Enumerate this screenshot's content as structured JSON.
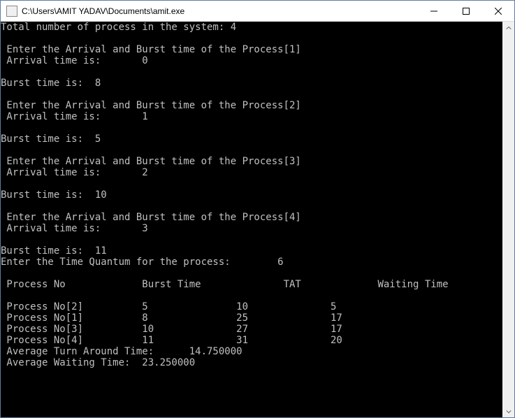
{
  "window": {
    "title": "C:\\Users\\AMIT YADAV\\Documents\\amit.exe"
  },
  "console": {
    "total_prompt": "Total number of process in the system: ",
    "total_value": "4",
    "processes": [
      {
        "idx": "1",
        "arrival": "0",
        "burst": "8"
      },
      {
        "idx": "2",
        "arrival": "1",
        "burst": "5"
      },
      {
        "idx": "3",
        "arrival": "2",
        "burst": "10"
      },
      {
        "idx": "4",
        "arrival": "3",
        "burst": "11"
      }
    ],
    "enter_ab_prefix": " Enter the Arrival and Burst time of the Process[",
    "enter_ab_suffix": "]",
    "arrival_label": " Arrival time is:       ",
    "burst_label": "Burst time is:  ",
    "quantum_prompt": "Enter the Time Quantum for the process:        ",
    "quantum_value": "6",
    "header": {
      "col1": " Process No",
      "col2": "Burst Time",
      "col3": "TAT",
      "col4": "Waiting Time"
    },
    "rows": [
      {
        "p": " Process No[2]",
        "bt": "5",
        "tat": "10",
        "wt": "5"
      },
      {
        "p": " Process No[1]",
        "bt": "8",
        "tat": "25",
        "wt": "17"
      },
      {
        "p": " Process No[3]",
        "bt": "10",
        "tat": "27",
        "wt": "17"
      },
      {
        "p": " Process No[4]",
        "bt": "11",
        "tat": "31",
        "wt": "20"
      }
    ],
    "avg_tat_label": " Average Turn Around Time:      ",
    "avg_tat_value": "14.750000",
    "avg_wt_label": " Average Waiting Time:  ",
    "avg_wt_value": "23.250000"
  }
}
